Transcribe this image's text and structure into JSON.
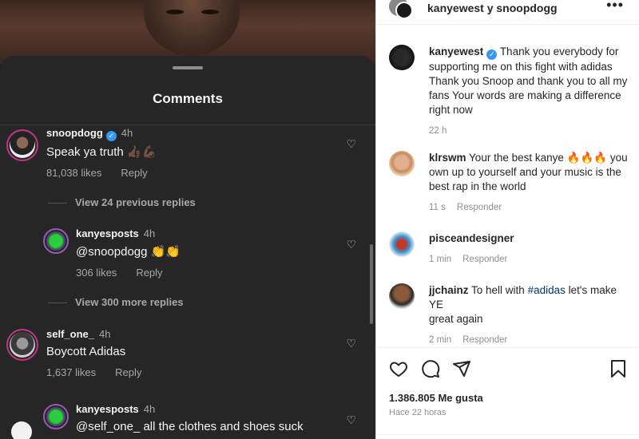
{
  "left": {
    "sheet_title": "Comments",
    "comments": [
      {
        "user": "snoopdogg",
        "time": "4h",
        "text": "Speak ya truth 👍🏿💪🏿",
        "likes": "81,038 likes",
        "reply": "Reply"
      },
      {
        "user": "kanyesposts",
        "time": "4h",
        "text": "@snoopdogg 👏👏",
        "likes": "306 likes",
        "reply": "Reply"
      },
      {
        "user": "self_one_",
        "time": "4h",
        "text": "Boycott Adidas",
        "likes": "1,637 likes",
        "reply": "Reply"
      },
      {
        "user": "kanyesposts",
        "time": "4h",
        "text": "@self_one_ all the clothes and shoes suck"
      }
    ],
    "view_previous": "View 24 previous replies",
    "view_more": "View 300 more replies"
  },
  "right": {
    "header_title": "kanyewest y snoopdogg",
    "caption": {
      "user": "kanyewest",
      "text": "Thank you everybody for supporting me on this fight with adidas Thank you Snoop and thank you to all my fans Your words are making a difference right now",
      "time": "22 h"
    },
    "comments": [
      {
        "user": "klrswm",
        "text": "Your the best kanye 🔥🔥🔥 you own up to yourself and your music is the best rap in the world",
        "time": "11 s",
        "reply": "Responder"
      },
      {
        "user": "pisceandesigner",
        "text": "",
        "time": "1 min",
        "reply": "Responder"
      },
      {
        "user": "jjchainz",
        "text_before": "To hell with ",
        "hashtag": "#adidas",
        "text_after": " let's make YE",
        "line2": "great again",
        "time": "2 min",
        "reply": "Responder"
      }
    ],
    "likes": "1.386.805 Me gusta",
    "ago": "Hace 22 horas"
  },
  "colors": {
    "ring": "#c13584",
    "verified": "#3897f0",
    "sheet_bg": "#262626"
  },
  "icons": [
    "heart-icon",
    "comment-icon",
    "share-icon",
    "bookmark-icon",
    "more-icon",
    "verified-icon"
  ]
}
